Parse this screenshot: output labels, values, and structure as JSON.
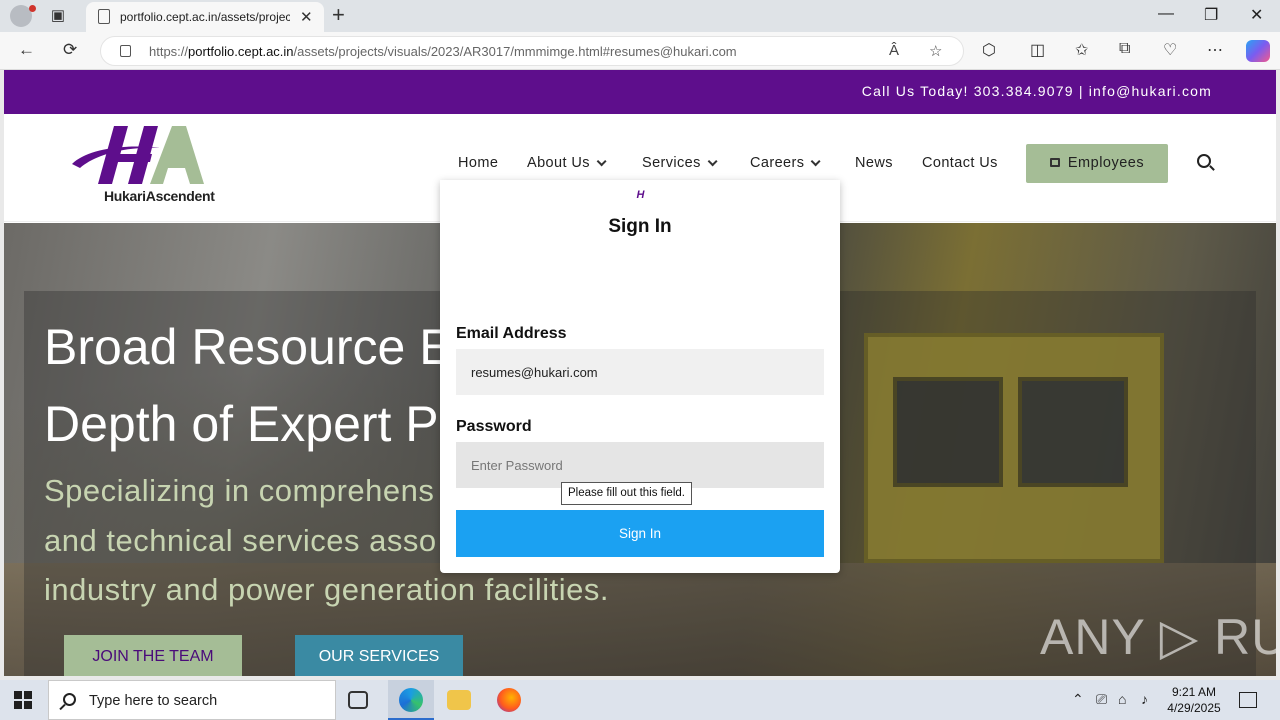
{
  "browser": {
    "tab_title": "portfolio.cept.ac.in/assets/projec",
    "url_prefix": "https://",
    "url_host": "portfolio.cept.ac.in",
    "url_path": "/assets/projects/visuals/2023/AR3017/mmmimge.html#resumes@hukari.com",
    "icons": {
      "profile": "profile-icon",
      "tabs": "tab-actions-icon",
      "close_tab": "✕",
      "new_tab": "+",
      "back": "←",
      "reload": "⟳",
      "read_aloud": "Â",
      "favorite": "☆",
      "extensions": "⬡",
      "split": "◫",
      "favorites": "✩",
      "collections": "⧉",
      "performance": "♡",
      "more": "⋯",
      "minimize": "—",
      "restore": "❐",
      "close": "✕"
    }
  },
  "site": {
    "topbar_contact": "Call Us Today!  303.384.9079 | info@hukari.com",
    "brand_name": "HukariAscendent",
    "logo_letters": "HA",
    "nav": {
      "home": "Home",
      "about": "About Us",
      "services": "Services",
      "careers": "Careers",
      "news": "News",
      "contact": "Contact Us",
      "employees": "Employees"
    },
    "hero": {
      "headline_1": "Broad Resource E",
      "headline_2": "Depth of Expert P",
      "sub_1": "Specializing in comprehens",
      "sub_2": "and technical services asso",
      "sub_3": "industry and power generation facilities.",
      "join_button": "JOIN THE TEAM",
      "services_button": "OUR SERVICES"
    },
    "watermark": "ANY ▷ RUN"
  },
  "modal": {
    "logo_mark": "H",
    "title": "Sign In",
    "email_label": "Email Address",
    "email_value": "resumes@hukari.com",
    "password_label": "Password",
    "password_placeholder": "Enter Password",
    "validation_tooltip": "Please fill out this field.",
    "submit_label": "Sign In"
  },
  "taskbar": {
    "search_placeholder": "Type here to search",
    "time": "9:21 AM",
    "date": "4/29/2025",
    "tray_icons": [
      "chevron-up-icon",
      "device-icon",
      "network-icon",
      "volume-icon"
    ]
  },
  "colors": {
    "brand_purple": "#5e0e8c",
    "brand_green": "#a5bd96",
    "signin_blue": "#1ba1f2",
    "services_teal": "#3a8aa3"
  }
}
